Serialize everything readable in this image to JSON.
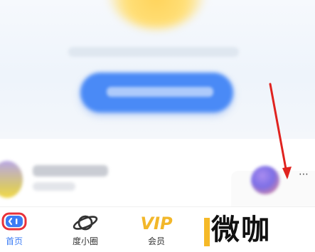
{
  "hero": {
    "caption": "",
    "cta_label": ""
  },
  "feed": {
    "username": "",
    "subline": "",
    "more_label": "⋯"
  },
  "tabbar": {
    "items": [
      {
        "label": "首页",
        "icon": "home-icon",
        "active": true
      },
      {
        "label": "度小圈",
        "icon": "planet-icon",
        "active": false
      },
      {
        "label": "会员",
        "icon": "vip-icon",
        "active": false
      }
    ]
  },
  "watermark": {
    "text": "微咖"
  },
  "colors": {
    "accent": "#3b7cf5",
    "cta": "#4a8af6",
    "vip_gold": "#f2b72a",
    "annotation_arrow": "#e0231f",
    "watermark_bar": "#f5b928"
  }
}
